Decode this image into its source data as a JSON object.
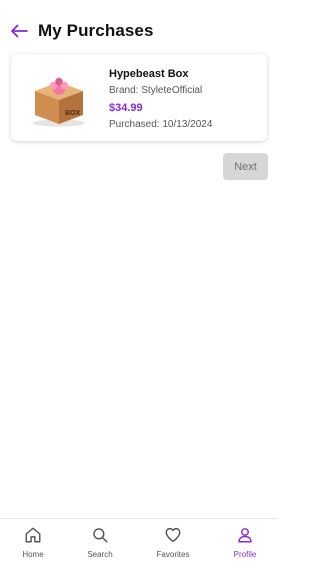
{
  "header": {
    "title": "My Purchases",
    "back_icon": "arrow-left-icon"
  },
  "purchases": [
    {
      "name": "Hypebeast Box",
      "brand": "Brand: StyleteOfficial",
      "price": "$34.99",
      "purchased": "Purchased: 10/13/2024",
      "thumbnail_icon": "box-product-icon",
      "thumbnail_text": "BOX"
    }
  ],
  "pagination": {
    "next_label": "Next",
    "next_enabled": false
  },
  "bottom_nav": {
    "items": [
      {
        "label": "Home",
        "icon": "home-icon",
        "active": false
      },
      {
        "label": "Search",
        "icon": "search-icon",
        "active": false
      },
      {
        "label": "Favorites",
        "icon": "heart-icon",
        "active": false
      },
      {
        "label": "Profile",
        "icon": "user-icon",
        "active": true
      }
    ]
  },
  "colors": {
    "accent": "#8a2bd0",
    "disabled_button_bg": "#d5d6d8",
    "disabled_button_text": "#6d6f73"
  }
}
